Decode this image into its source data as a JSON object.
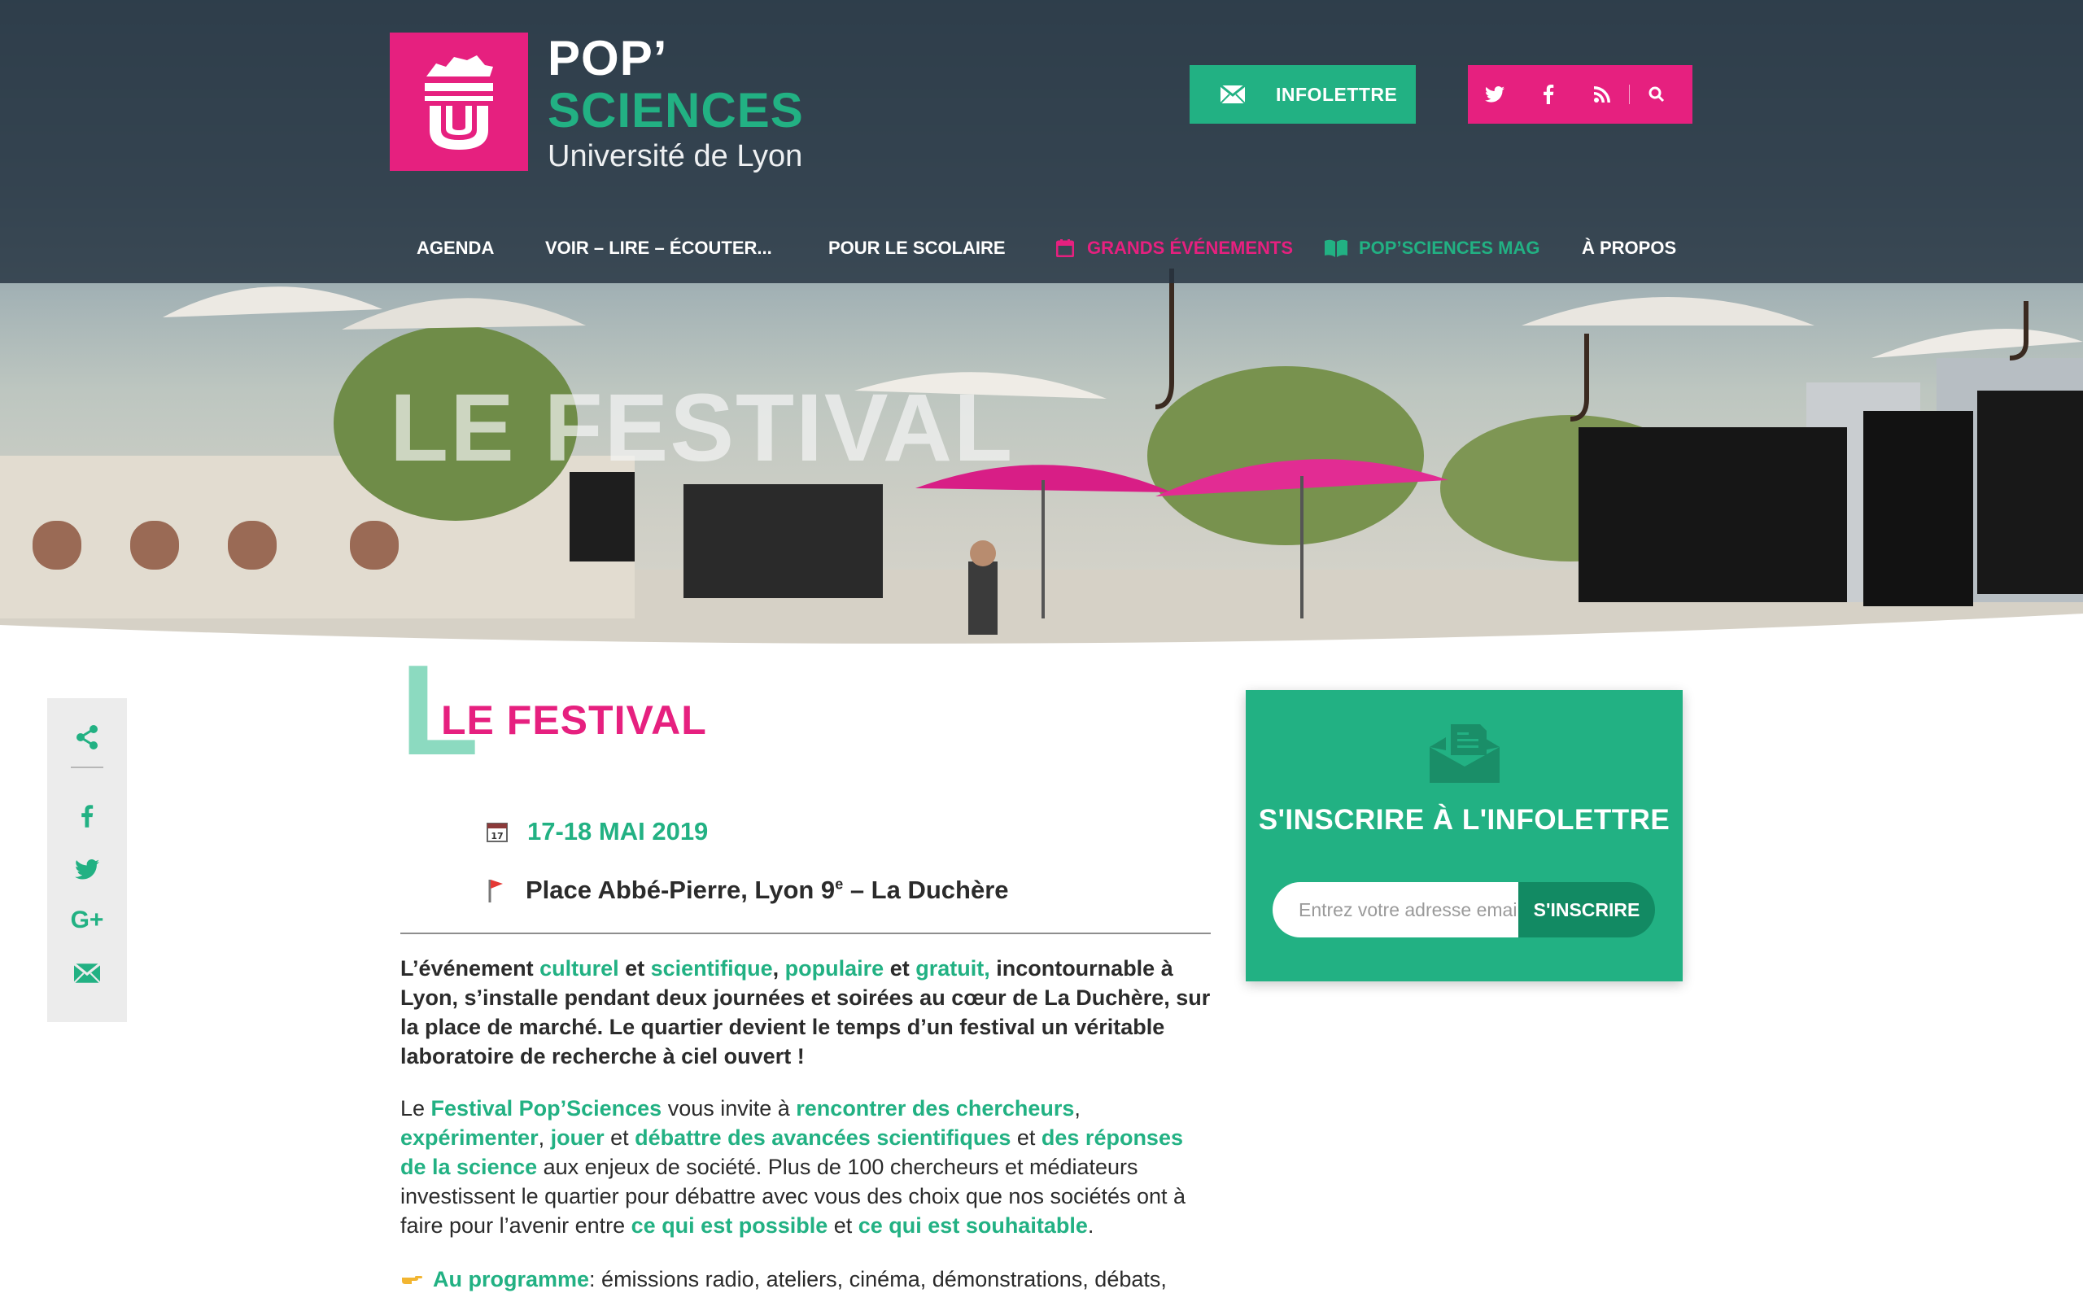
{
  "brand": {
    "line1": "POP’",
    "line2": "SCIENCES",
    "line3": "Université de Lyon"
  },
  "header": {
    "newsletter_button": "INFOLETTRE",
    "social": [
      "twitter-icon",
      "facebook-icon",
      "rss-icon",
      "search-icon"
    ]
  },
  "nav": {
    "items": [
      {
        "label": "AGENDA"
      },
      {
        "label": "VOIR – LIRE – ÉCOUTER..."
      },
      {
        "label": "POUR LE SCOLAIRE"
      },
      {
        "label": "GRANDS ÉVÉNEMENTS",
        "icon": "calendar-icon",
        "color": "#e6207f"
      },
      {
        "label": "POP’SCIENCES MAG",
        "icon": "book-icon",
        "color": "#22b183"
      },
      {
        "label": "À PROPOS"
      }
    ]
  },
  "hero": {
    "title": "LE FESTIVAL"
  },
  "share": {
    "icons": [
      "share-icon",
      "facebook-icon",
      "twitter-icon",
      "google-plus-icon",
      "email-icon"
    ],
    "gplus_label": "G+"
  },
  "article": {
    "heading_letter": "L",
    "heading": "LE FESTIVAL",
    "date": "17-18 MAI 2019",
    "place_main": "Place Abbé-Pierre, Lyon 9",
    "place_sup": "e",
    "place_rest": " – La Duchère",
    "p1": {
      "t1": "L’événement ",
      "g1": "culturel",
      "t2": " et ",
      "g2": "scientifique",
      "t3": ", ",
      "g3": "populaire",
      "t4": " et ",
      "g4": "gratuit,",
      "t5": " incontournable à Lyon, s’installe pendant deux journées et soirées au cœur de La Duchère, sur la place de marché. Le quartier devient le temps d’un festival un véritable laboratoire de recherche à ciel ouvert !"
    },
    "p2": {
      "t1": "Le ",
      "g1": "Festival Pop’Sciences",
      "t2": " vous invite à ",
      "g2": "rencontrer des chercheurs",
      "t3": ", ",
      "g3": "expérimenter",
      "t4": ", ",
      "g4": "jouer",
      "t5": " et ",
      "g5": "débattre des avancées scientifiques",
      "t6": " et ",
      "g6": "des réponses de la science",
      "t7": " aux enjeux de société. Plus de 100 chercheurs et médiateurs investissent le quartier pour débattre avec vous des choix que nos sociétés ont à faire pour l’avenir entre ",
      "g7": "ce qui est possible",
      "t8": " et ",
      "g8": "ce qui est souhaitable",
      "t9": "."
    },
    "p3": {
      "g1": "Au programme",
      "t1": " : émissions radio, ateliers, cinéma, démonstrations, débats,"
    }
  },
  "newsletter": {
    "title": "S'INSCRIRE À L'INFOLETTRE",
    "placeholder": "Entrez votre adresse email",
    "button": "S'INSCRIRE"
  },
  "colors": {
    "pink": "#e6207f",
    "green": "#22b183",
    "nav_overlay": "#263442"
  }
}
